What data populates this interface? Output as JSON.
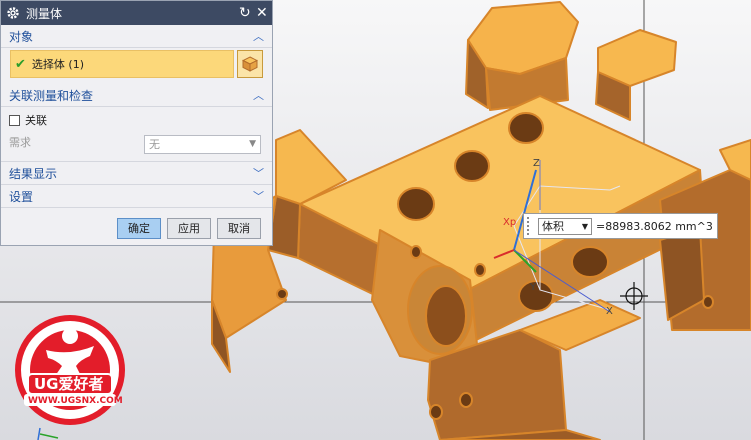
{
  "dialog": {
    "title": "测量体",
    "sections": {
      "object": {
        "title": "对象",
        "chevron": "up"
      },
      "assoc": {
        "title": "关联测量和检查",
        "chevron": "up"
      },
      "results": {
        "title": "结果显示",
        "chevron": "down"
      },
      "settings": {
        "title": "设置",
        "chevron": "down"
      }
    },
    "select_body_label": "选择体 (1)",
    "associative_label": "关联",
    "associative_checked": false,
    "requirement_label": "需求",
    "requirement_value": "无",
    "buttons": {
      "ok": "确定",
      "apply": "应用",
      "cancel": "取消"
    }
  },
  "measure": {
    "type_value": "体积",
    "result": "=88983.8062 mm^3"
  },
  "axes": {
    "z": "Z",
    "xp": "Xp",
    "y": "Y",
    "x": "X"
  },
  "logo": {
    "brand": "UG爱好者",
    "url": "WWW.UGSNX.COM"
  },
  "colors": {
    "part": "#f4a83a",
    "title_bar": "#3d4a63",
    "highlight": "#fcd87a"
  },
  "icons": [
    "gear-icon",
    "reset-icon",
    "close-icon",
    "checkmark-icon",
    "cube-select-icon",
    "chevron-up-icon",
    "chevron-down-icon",
    "dropdown-arrow-icon",
    "crosshair-cursor-icon"
  ]
}
